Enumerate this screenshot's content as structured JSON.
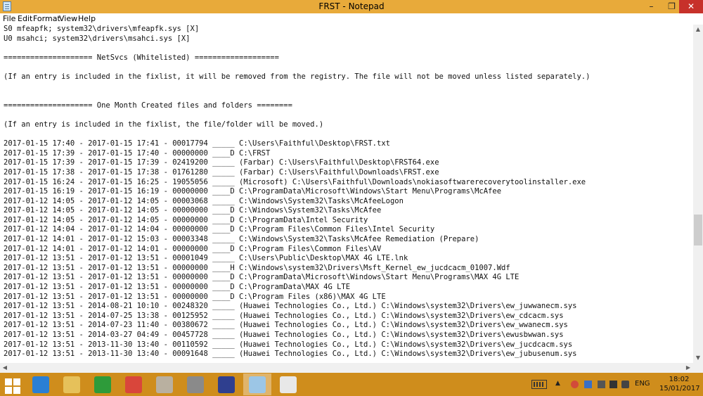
{
  "window": {
    "title": "FRST - Notepad",
    "min_glyph": "–",
    "max_glyph": "❐",
    "close_glyph": "✕"
  },
  "menu": [
    "File",
    "Edit",
    "Format",
    "View",
    "Help"
  ],
  "lines": [
    "S0 mfeapfk; system32\\drivers\\mfeapfk.sys [X]",
    "U0 msahci; system32\\drivers\\msahci.sys [X]",
    "",
    "==================== NetSvcs (Whitelisted) ===================",
    "",
    "(If an entry is included in the fixlist, it will be removed from the registry. The file will not be moved unless listed separately.)",
    "",
    "",
    "==================== One Month Created files and folders ========",
    "",
    "(If an entry is included in the fixlist, the file/folder will be moved.)",
    "",
    "2017-01-15 17:40 - 2017-01-15 17:41 - 00017794 _____ C:\\Users\\Faithful\\Desktop\\FRST.txt",
    "2017-01-15 17:39 - 2017-01-15 17:40 - 00000000 ____D C:\\FRST",
    "2017-01-15 17:39 - 2017-01-15 17:39 - 02419200 _____ (Farbar) C:\\Users\\Faithful\\Desktop\\FRST64.exe",
    "2017-01-15 17:38 - 2017-01-15 17:38 - 01761280 _____ (Farbar) C:\\Users\\Faithful\\Downloads\\FRST.exe",
    "2017-01-15 16:24 - 2017-01-15 16:25 - 19055056 _____ (Microsoft) C:\\Users\\Faithful\\Downloads\\nokiasoftwarerecoverytoolinstaller.exe",
    "2017-01-15 16:19 - 2017-01-15 16:19 - 00000000 ____D C:\\ProgramData\\Microsoft\\Windows\\Start Menu\\Programs\\McAfee",
    "2017-01-12 14:05 - 2017-01-12 14:05 - 00003068 _____ C:\\Windows\\System32\\Tasks\\McAfeeLogon",
    "2017-01-12 14:05 - 2017-01-12 14:05 - 00000000 ____D C:\\Windows\\System32\\Tasks\\McAfee",
    "2017-01-12 14:05 - 2017-01-12 14:05 - 00000000 ____D C:\\ProgramData\\Intel Security",
    "2017-01-12 14:04 - 2017-01-12 14:04 - 00000000 ____D C:\\Program Files\\Common Files\\Intel Security",
    "2017-01-12 14:01 - 2017-01-12 15:03 - 00003348 _____ C:\\Windows\\System32\\Tasks\\McAfee Remediation (Prepare)",
    "2017-01-12 14:01 - 2017-01-12 14:01 - 00000000 ____D C:\\Program Files\\Common Files\\AV",
    "2017-01-12 13:51 - 2017-01-12 13:51 - 00001049 _____ C:\\Users\\Public\\Desktop\\MAX 4G LTE.lnk",
    "2017-01-12 13:51 - 2017-01-12 13:51 - 00000000 ____H C:\\Windows\\system32\\Drivers\\Msft_Kernel_ew_jucdcacm_01007.Wdf",
    "2017-01-12 13:51 - 2017-01-12 13:51 - 00000000 ____D C:\\ProgramData\\Microsoft\\Windows\\Start Menu\\Programs\\MAX 4G LTE",
    "2017-01-12 13:51 - 2017-01-12 13:51 - 00000000 ____D C:\\ProgramData\\MAX 4G LTE",
    "2017-01-12 13:51 - 2017-01-12 13:51 - 00000000 ____D C:\\Program Files (x86)\\MAX 4G LTE",
    "2017-01-12 13:51 - 2014-08-21 10:10 - 00248320 _____ (Huawei Technologies Co., Ltd.) C:\\Windows\\system32\\Drivers\\ew_juwwanecm.sys",
    "2017-01-12 13:51 - 2014-07-25 13:38 - 00125952 _____ (Huawei Technologies Co., Ltd.) C:\\Windows\\system32\\Drivers\\ew_cdcacm.sys",
    "2017-01-12 13:51 - 2014-07-23 11:40 - 00380672 _____ (Huawei Technologies Co., Ltd.) C:\\Windows\\system32\\Drivers\\ew_wwanecm.sys",
    "2017-01-12 13:51 - 2014-03-27 04:49 - 00457728 _____ (Huawei Technologies Co., Ltd.) C:\\Windows\\system32\\Drivers\\ewusbwwan.sys",
    "2017-01-12 13:51 - 2013-11-30 13:40 - 00110592 _____ (Huawei Technologies Co., Ltd.) C:\\Windows\\system32\\Drivers\\ew_jucdcacm.sys",
    "2017-01-12 13:51 - 2013-11-30 13:40 - 00091648 _____ (Huawei Technologies Co., Ltd.) C:\\Windows\\system32\\Drivers\\ew_jubusenum.sys"
  ],
  "scrollbar": {
    "up": "▲",
    "down": "▼",
    "left": "◀",
    "right": "▶"
  },
  "taskbar": {
    "apps": [
      {
        "name": "internet-explorer",
        "color": "#2a7fd4"
      },
      {
        "name": "file-explorer",
        "color": "#e6c15a"
      },
      {
        "name": "store",
        "color": "#2e9b3a"
      },
      {
        "name": "chrome",
        "color": "#d9463b"
      },
      {
        "name": "notepad-tool",
        "color": "#b9b0a0"
      },
      {
        "name": "printer",
        "color": "#8a8a8a"
      },
      {
        "name": "frst-tool",
        "color": "#2f3f8f"
      },
      {
        "name": "notepad",
        "color": "#9cc6e6",
        "active": true
      },
      {
        "name": "paint",
        "color": "#e8e8e8"
      }
    ],
    "tray": {
      "chevron": "▲",
      "lang": "ENG",
      "time": "18:02",
      "date": "15/01/2017"
    }
  }
}
